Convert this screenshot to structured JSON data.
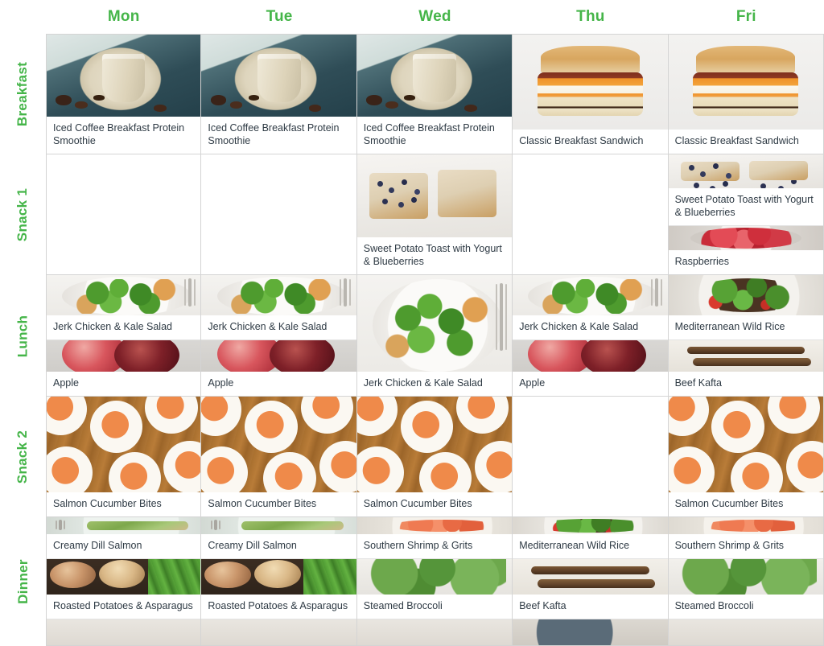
{
  "theme": {
    "accent_green": "#45B549",
    "grid_line": "#d4d4d4",
    "caption_text": "#2e3a44"
  },
  "days": [
    {
      "key": "mon",
      "label": "Mon"
    },
    {
      "key": "tue",
      "label": "Tue"
    },
    {
      "key": "wed",
      "label": "Wed"
    },
    {
      "key": "thu",
      "label": "Thu"
    },
    {
      "key": "fri",
      "label": "Fri"
    }
  ],
  "meals": [
    {
      "key": "breakfast",
      "label": "Breakfast"
    },
    {
      "key": "snack1",
      "label": "Snack 1"
    },
    {
      "key": "lunch",
      "label": "Lunch"
    },
    {
      "key": "snack2",
      "label": "Snack 2"
    },
    {
      "key": "dinner",
      "label": "Dinner"
    }
  ],
  "grid": {
    "breakfast": {
      "mon": [
        {
          "title": "Iced Coffee Breakfast Protein Smoothie",
          "art": "art-smoothie"
        }
      ],
      "tue": [
        {
          "title": "Iced Coffee Breakfast Protein Smoothie",
          "art": "art-smoothie"
        }
      ],
      "wed": [
        {
          "title": "Iced Coffee Breakfast Protein Smoothie",
          "art": "art-smoothie"
        }
      ],
      "thu": [
        {
          "title": "Classic Breakfast Sandwich",
          "art": "art-sandwich"
        }
      ],
      "fri": [
        {
          "title": "Classic Breakfast Sandwich",
          "art": "art-sandwich"
        }
      ]
    },
    "snack1": {
      "mon": [],
      "tue": [],
      "wed": [
        {
          "title": "Sweet Potato Toast with Yogurt & Blueberries",
          "art": "art-sptoast"
        }
      ],
      "thu": [],
      "fri": [
        {
          "title": "Sweet Potato Toast with Yogurt & Blueberries",
          "art": "art-sptoast"
        },
        {
          "title": "Raspberries",
          "art": "art-raspberry"
        }
      ]
    },
    "lunch": {
      "mon": [
        {
          "title": "Jerk Chicken & Kale Salad",
          "art": "art-kale"
        },
        {
          "title": "Apple",
          "art": "art-apple"
        }
      ],
      "tue": [
        {
          "title": "Jerk Chicken & Kale Salad",
          "art": "art-kale"
        },
        {
          "title": "Apple",
          "art": "art-apple"
        }
      ],
      "wed": [
        {
          "title": "Jerk Chicken & Kale Salad",
          "art": "art-kale"
        }
      ],
      "thu": [
        {
          "title": "Jerk Chicken & Kale Salad",
          "art": "art-kale"
        },
        {
          "title": "Apple",
          "art": "art-apple"
        }
      ],
      "fri": [
        {
          "title": "Mediterranean Wild Rice",
          "art": "art-wildrice"
        },
        {
          "title": "Beef Kafta",
          "art": "art-kafta"
        }
      ]
    },
    "snack2": {
      "mon": [
        {
          "title": "Salmon Cucumber Bites",
          "art": "art-bites"
        }
      ],
      "tue": [
        {
          "title": "Salmon Cucumber Bites",
          "art": "art-bites"
        }
      ],
      "wed": [
        {
          "title": "Salmon Cucumber Bites",
          "art": "art-bites"
        }
      ],
      "thu": [],
      "fri": [
        {
          "title": "Salmon Cucumber Bites",
          "art": "art-bites"
        }
      ]
    },
    "dinner": {
      "mon": [
        {
          "title": "Creamy Dill Salmon",
          "art": "art-dillsalmon"
        },
        {
          "title": "Roasted Potatoes & Asparagus",
          "art": "art-potatoes"
        },
        {
          "title": "",
          "art": "art-clipped"
        }
      ],
      "tue": [
        {
          "title": "Creamy Dill Salmon",
          "art": "art-dillsalmon"
        },
        {
          "title": "Roasted Potatoes & Asparagus",
          "art": "art-potatoes"
        },
        {
          "title": "",
          "art": "art-clipped"
        }
      ],
      "wed": [
        {
          "title": "Southern Shrimp & Grits",
          "art": "art-shrimp"
        },
        {
          "title": "Steamed Broccoli",
          "art": "art-broccoli"
        },
        {
          "title": "",
          "art": "art-clipped"
        }
      ],
      "thu": [
        {
          "title": "Mediterranean Wild Rice",
          "art": "art-wildrice"
        },
        {
          "title": "Beef Kafta",
          "art": "art-kafta"
        },
        {
          "title": "",
          "art": "art-clipped2"
        }
      ],
      "fri": [
        {
          "title": "Southern Shrimp & Grits",
          "art": "art-shrimp"
        },
        {
          "title": "Steamed Broccoli",
          "art": "art-broccoli"
        },
        {
          "title": "",
          "art": "art-clipped"
        }
      ]
    }
  }
}
